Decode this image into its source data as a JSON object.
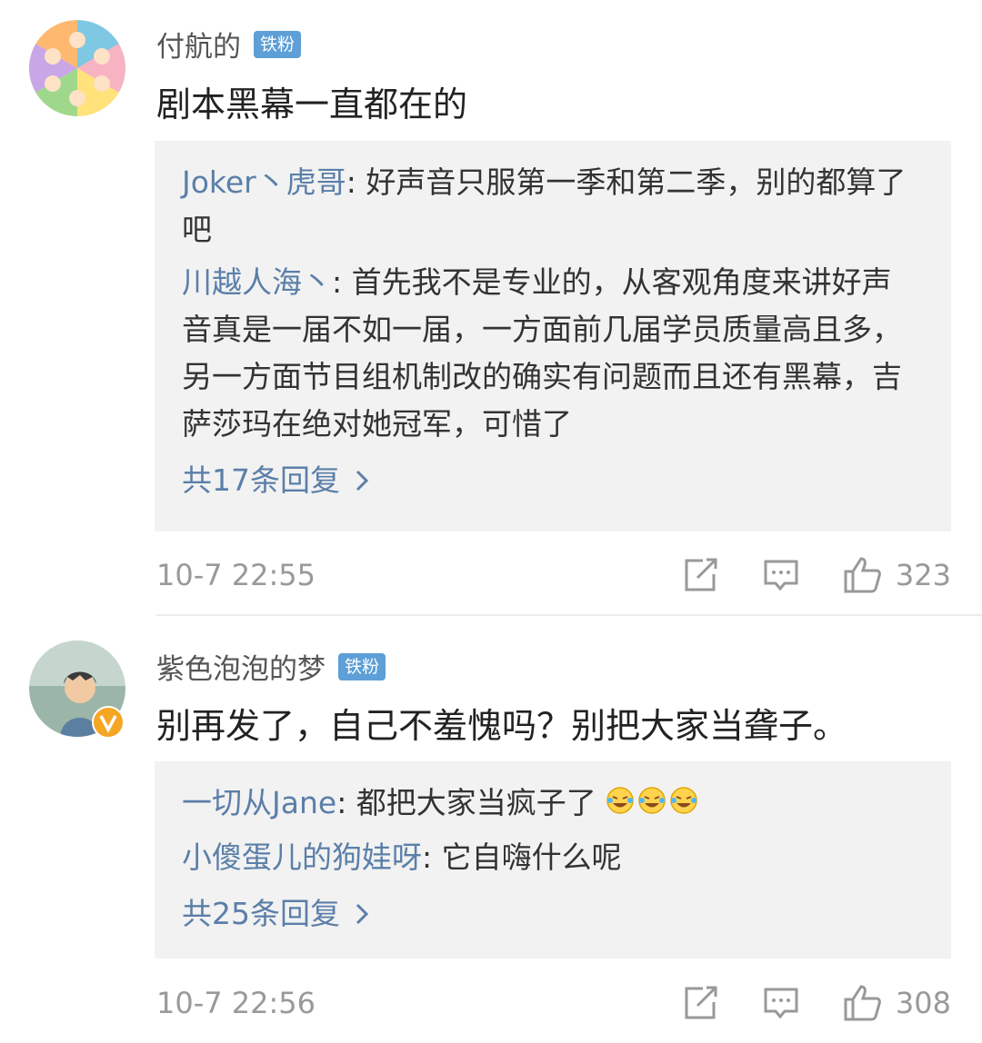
{
  "comments": [
    {
      "username": "付航的",
      "badge": "铁粉",
      "text": "剧本黑幕一直都在的",
      "replies": [
        {
          "name": "Joker丶虎哥",
          "text": ": 好声音只服第一季和第二季，别的都算了吧"
        },
        {
          "name": "川越人海丶",
          "text": ": 首先我不是专业的，从客观角度来讲好声音真是一届不如一届，一方面前几届学员质量高且多，另一方面节目组机制改的确实有问题而且还有黑幕，吉萨莎玛在绝对她冠军，可惜了"
        }
      ],
      "more": "共17条回复",
      "time": "10-7 22:55",
      "likes": "323"
    },
    {
      "username": "紫色泡泡的梦",
      "badge": "铁粉",
      "verified": "V",
      "text": "别再发了，自己不羞愧吗？别把大家当聋子。",
      "replies": [
        {
          "name": "一切从Jane",
          "text": ": 都把大家当疯子了"
        },
        {
          "name": "小傻蛋儿的狗娃呀",
          "text": ": 它自嗨什么呢"
        }
      ],
      "more": "共25条回复",
      "time": "10-7 22:56",
      "likes": "308"
    }
  ],
  "icons": {
    "share": "share-icon",
    "comment": "comment-icon",
    "like": "thumbs-up-icon",
    "more_arrow": "chevron-right-icon",
    "emoji": "laugh-cry-emoji-icon"
  },
  "colors": {
    "name_link": "#5b7fa8",
    "badge": "#5d9fd6",
    "reply_bg": "#f2f2f2",
    "verified": "#f5a623"
  }
}
